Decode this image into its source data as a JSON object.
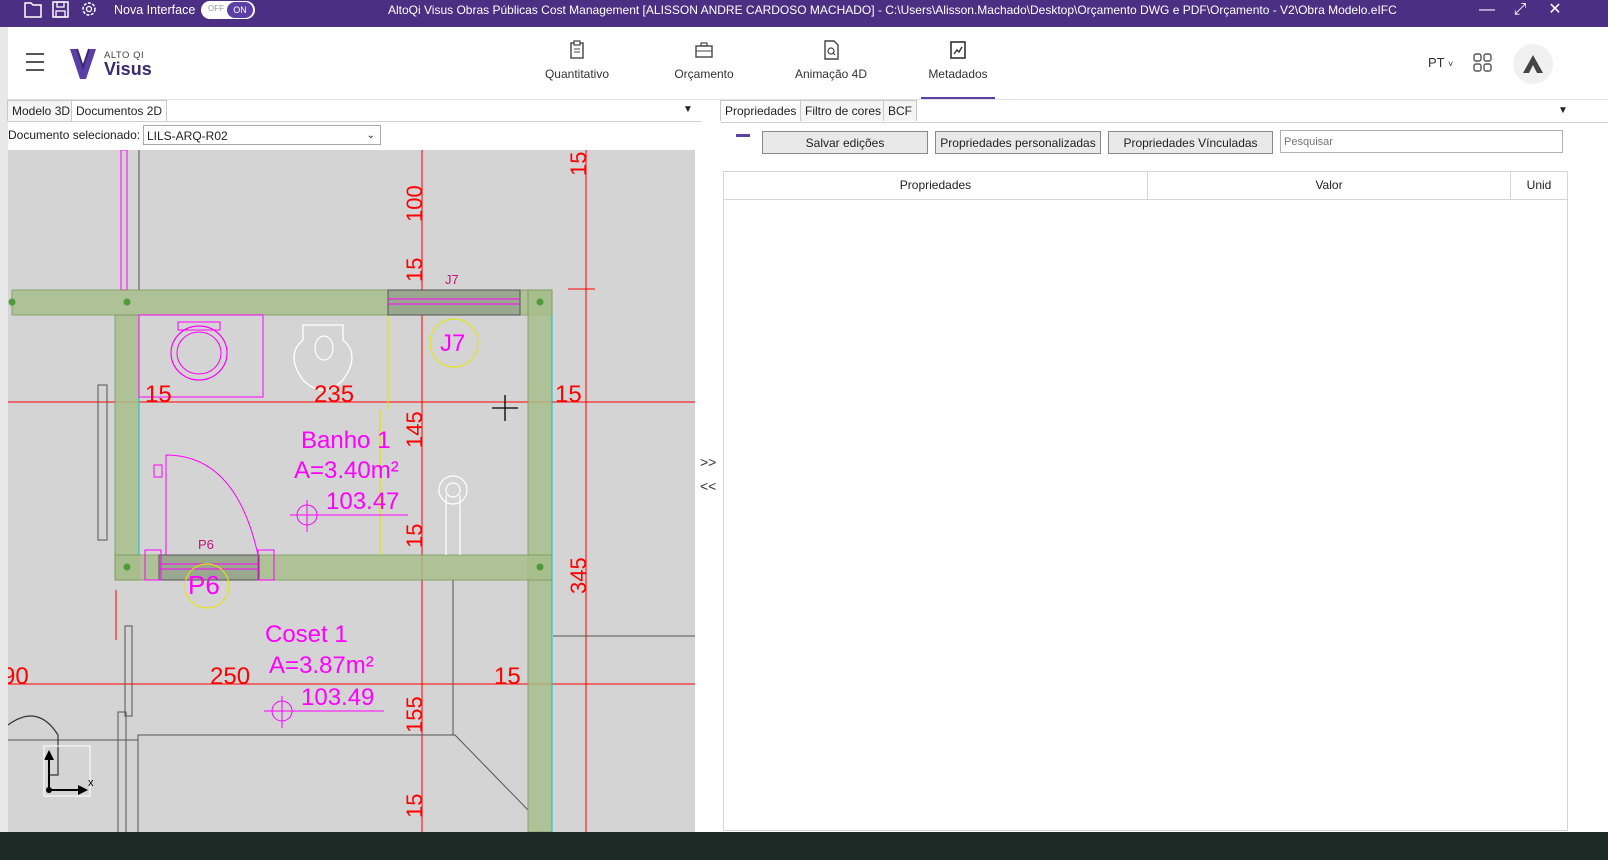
{
  "titlebar": {
    "nova_label": "Nova Interface",
    "toggle_off": "OFF",
    "toggle_on": "ON",
    "window_title": "AltoQi Visus Obras Públicas Cost Management [ALISSON ANDRE CARDOSO MACHADO] - C:\\Users\\Alisson.Machado\\Desktop\\Orçamento DWG e PDF\\Orçamento - V2\\Obra Modelo.eIFC",
    "minimize": "—",
    "maximize": "⤢",
    "close": "✕"
  },
  "header": {
    "logo_alto": "ALTO QI",
    "logo_visus": "Visus",
    "tabs": [
      {
        "label": "Quantitativo",
        "icon": "clipboard-icon"
      },
      {
        "label": "Orçamento",
        "icon": "briefcase-icon"
      },
      {
        "label": "Animação 4D",
        "icon": "document-search-icon"
      },
      {
        "label": "Metadados",
        "icon": "chart-document-icon",
        "active": true
      }
    ],
    "lang": "PT",
    "lang_chevron": "˅"
  },
  "left_panel": {
    "tabs": [
      "Modelo 3D",
      "Documentos 2D"
    ],
    "active_tab": "Documentos 2D",
    "doc_label": "Documento selecionado:",
    "doc_value": "LILS-ARQ-R02",
    "panel_menu": "▼"
  },
  "drawing": {
    "dims": {
      "d15_top": "15",
      "d100": "100",
      "d15_a": "15",
      "d15_left": "15",
      "d235": "235",
      "d15_right": "15",
      "d145": "145",
      "d15_b": "15",
      "d345": "345",
      "d90": "90",
      "d250": "250",
      "d15_c": "15",
      "d155": "155",
      "d15_bottom": "15"
    },
    "labels": {
      "j7_small": "J7",
      "j7": "J7",
      "p6_small": "P6",
      "p6": "P6",
      "room1_name": "Banho 1",
      "room1_area": "A=3.40m²",
      "room1_level": "103.47",
      "room2_name": "Coset 1",
      "room2_area": "A=3.87m²",
      "room2_level": "103.49",
      "axis_x": "x"
    },
    "colors": {
      "dim": "#ff0000",
      "room": "#ff00ff",
      "wall": "#a9be8c",
      "background": "#d4d4d4"
    }
  },
  "splitter": {
    "expand": ">>",
    "collapse": "<<"
  },
  "right_panel": {
    "tabs": [
      "Propriedades",
      "Filtro de cores",
      "BCF"
    ],
    "active_tab": "Propriedades",
    "panel_menu": "▼",
    "buttons": {
      "save": "Salvar edições",
      "custom": "Propriedades personalizadas",
      "linked": "Propriedades Vínculadas"
    },
    "search_placeholder": "Pesquisar",
    "columns": [
      "Propriedades",
      "Valor",
      "Unid"
    ]
  }
}
